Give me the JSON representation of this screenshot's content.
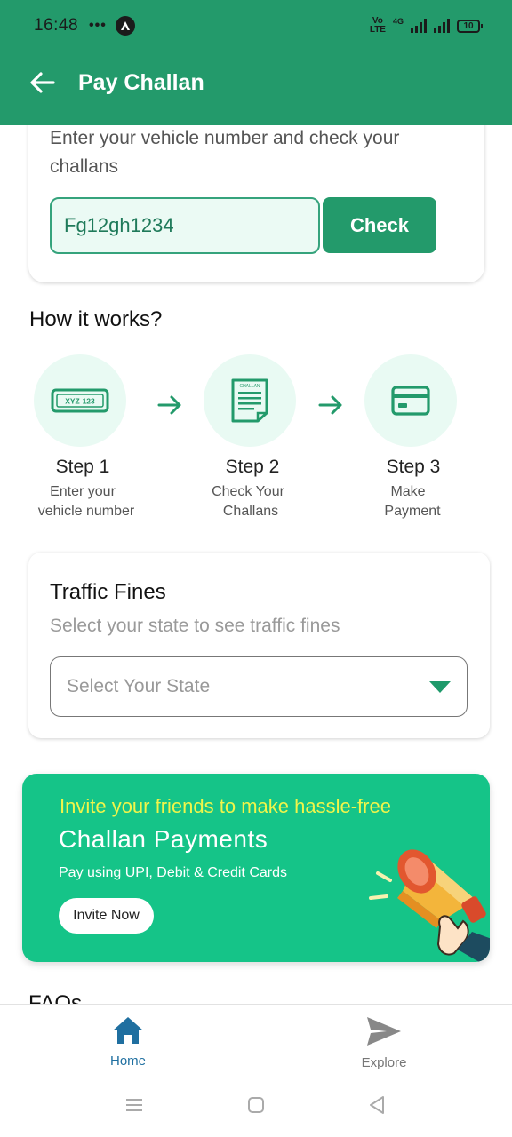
{
  "status_bar": {
    "time": "16:48",
    "dots": "•••",
    "volte": "Vo LTE",
    "network": "4G",
    "battery": "10"
  },
  "header": {
    "title": "Pay Challan"
  },
  "check_card": {
    "description": "Enter your vehicle number and check your challans",
    "vehicle_number_value": "Fg12gh1234",
    "check_label": "Check"
  },
  "how_it_works": {
    "title": "How it works?",
    "plate_text": "XYZ-123",
    "doc_text": "CHALLAN",
    "steps": [
      {
        "title": "Step 1",
        "desc_line1": "Enter your",
        "desc_line2": "vehicle number",
        "icon": "license-plate-icon"
      },
      {
        "title": "Step 2",
        "desc_line1": "Check Your",
        "desc_line2": "Challans",
        "icon": "challan-document-icon"
      },
      {
        "title": "Step 3",
        "desc_line1": "Make",
        "desc_line2": "Payment",
        "icon": "card-payment-icon"
      }
    ]
  },
  "traffic_fines": {
    "title": "Traffic Fines",
    "subtitle": "Select your state to see traffic fines",
    "select_placeholder": "Select Your State"
  },
  "banner": {
    "line1": "Invite your friends to make hassle-free",
    "line2": "Challan Payments",
    "line3": "Pay using UPI, Debit & Credit Cards",
    "button_label": "Invite Now"
  },
  "faq_heading_partial": "FAQs",
  "bottom_nav": {
    "home_label": "Home",
    "explore_label": "Explore"
  },
  "colors": {
    "primary": "#239a6b",
    "banner": "#15c488",
    "banner_highlight": "#f0f54a",
    "step_bg": "#e9faf3",
    "nav_active": "#1f6fa0"
  }
}
